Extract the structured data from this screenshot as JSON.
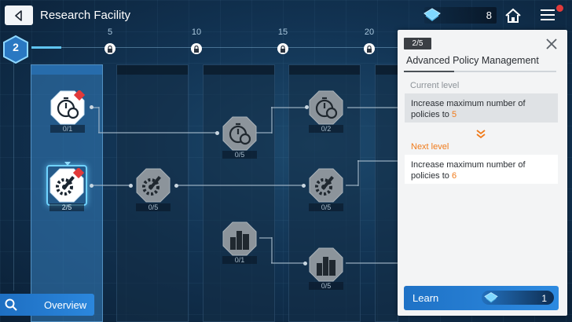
{
  "header": {
    "title": "Research Facility",
    "points": "8"
  },
  "level": {
    "current": "2",
    "progress": 0.4,
    "ruler_marks": [
      "5",
      "10",
      "15",
      "20"
    ]
  },
  "tree": {
    "nodes": [
      {
        "id": "policy-1",
        "icon": "stopwatch-icon",
        "count": "0/1"
      },
      {
        "id": "policy-2",
        "icon": "stopwatch-icon",
        "count": "0/5"
      },
      {
        "id": "policy-3",
        "icon": "stopwatch-icon",
        "count": "0/2"
      },
      {
        "id": "gear-1",
        "icon": "gear-wrench-icon",
        "count": "2/5",
        "selected": true
      },
      {
        "id": "gear-2",
        "icon": "gear-wrench-icon",
        "count": "0/5"
      },
      {
        "id": "gear-3",
        "icon": "gear-wrench-icon",
        "count": "0/5"
      },
      {
        "id": "city-1",
        "icon": "city-icon",
        "count": "0/1"
      },
      {
        "id": "city-2",
        "icon": "city-icon",
        "count": "0/5"
      }
    ]
  },
  "overview": {
    "label": "Overview"
  },
  "panel": {
    "level": "2/5",
    "title": "Advanced Policy Management",
    "current_label": "Current level",
    "current_text": "Increase maximum number of policies to",
    "current_value": "5",
    "next_label": "Next level",
    "next_text": "Increase maximum number of policies to",
    "next_value": "6",
    "learn_label": "Learn",
    "learn_cost": "1"
  },
  "colors": {
    "accent": "#2d8ae0",
    "highlight": "#f07a1a",
    "badge": "#e23a3a"
  }
}
